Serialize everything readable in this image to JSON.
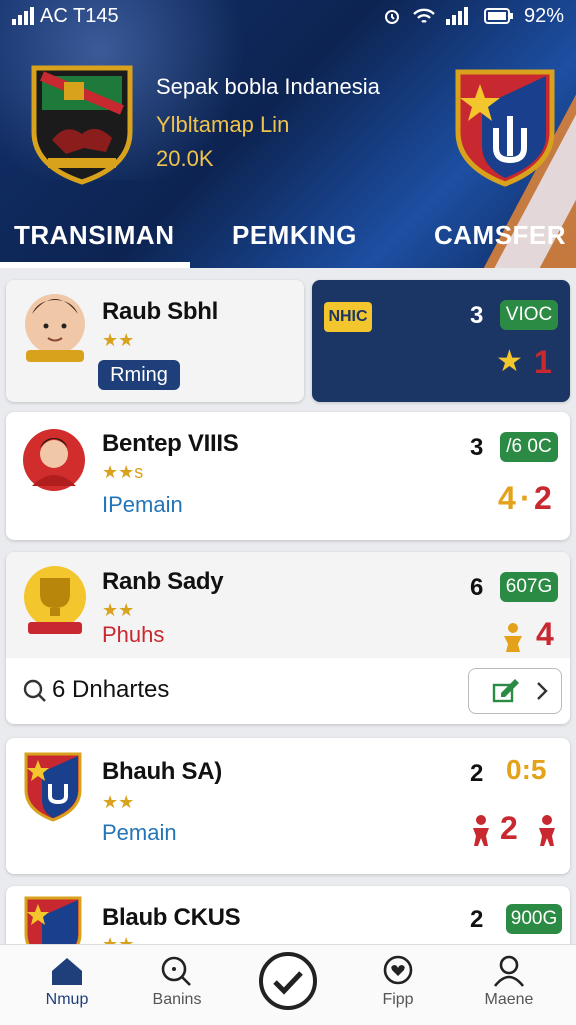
{
  "status_bar": {
    "left": "AC T145",
    "right": "92%"
  },
  "header": {
    "title": "Sepak bobla Indanesia",
    "subtitle": "Ylbltamap Lin",
    "count": "20.0K",
    "tabs": [
      {
        "label": "TRANSIMAN",
        "active": true
      },
      {
        "label": "PEMKING",
        "active": false
      },
      {
        "label": "CAMSFER",
        "active": false
      }
    ]
  },
  "featured": {
    "name": "Raub Sbhl",
    "stars": "★★",
    "role_button": "Rming",
    "panel_badge": "NHIC",
    "num": "3",
    "badge": "VIOC",
    "star_icon": "★",
    "stat": "1"
  },
  "players": [
    {
      "name": "Bentep VIIIS",
      "stars": "★★s",
      "role": "IPemain",
      "num": "3",
      "badge": "/6 0C",
      "stat_a": "4",
      "stat_sep": "·",
      "stat_b": "2"
    },
    {
      "name": "Ranb Sady",
      "stars": "★★",
      "role": "Phuhs",
      "num": "6",
      "badge": "607G",
      "stat_b": "4"
    },
    {
      "name": "Bhauh SA)",
      "stars": "★★",
      "role": "Pemain",
      "num": "2",
      "badge": "",
      "stat_a": "0:5",
      "stat_b": "2"
    },
    {
      "name": "Blaub CKUS",
      "stars": "★★",
      "role": "",
      "num": "2",
      "badge": "900G"
    }
  ],
  "search": {
    "value": "6 Dnhartes"
  },
  "bottom_nav": [
    {
      "label": "Nmup",
      "icon": "home-icon",
      "active": true
    },
    {
      "label": "Banins",
      "icon": "search-icon",
      "active": false
    },
    {
      "label": "",
      "icon": "check-circle-icon",
      "active": false
    },
    {
      "label": "Fipp",
      "icon": "heart-badge-icon",
      "active": false
    },
    {
      "label": "Maene",
      "icon": "profile-icon",
      "active": false
    }
  ],
  "colors": {
    "header_bg": "#12306b",
    "accent_gold": "#d8a21d",
    "stat_red": "#c8282f",
    "badge_green": "#2b8a44",
    "role_blue": "#2474b8"
  }
}
